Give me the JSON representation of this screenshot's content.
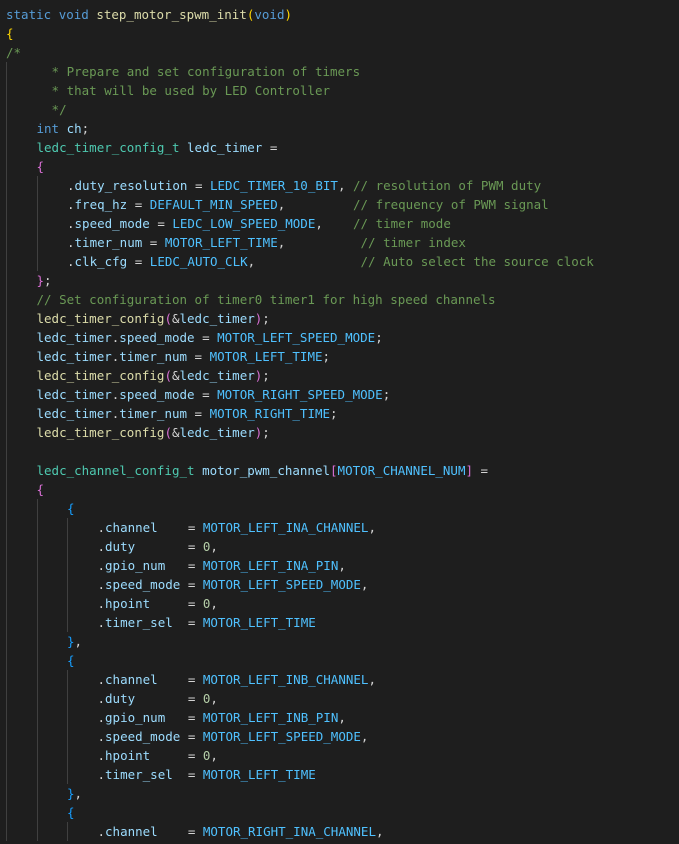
{
  "editor": {
    "language": "c",
    "colors": {
      "background": "#1e1e1e",
      "keyword": "#569cd6",
      "function": "#dcdcaa",
      "type": "#4ec9b0",
      "variable": "#9cdcfe",
      "macro": "#4fc1ff",
      "number": "#b5cea8",
      "comment": "#6a9955",
      "punctuation": "#d4d4d4",
      "bracket_level_1": "#ffd700",
      "bracket_level_2": "#da70d6",
      "bracket_level_3": "#179fff"
    },
    "lines": [
      {
        "indent": 0,
        "tokens": [
          [
            "kw",
            "static"
          ],
          [
            "pn",
            " "
          ],
          [
            "kw",
            "void"
          ],
          [
            "pn",
            " "
          ],
          [
            "fn",
            "step_motor_spwm_init"
          ],
          [
            "b1",
            "("
          ],
          [
            "kw",
            "void"
          ],
          [
            "b1",
            ")"
          ]
        ]
      },
      {
        "indent": 0,
        "tokens": [
          [
            "b1",
            "{"
          ]
        ]
      },
      {
        "indent": 0,
        "tokens": [
          [
            "cm",
            "/*"
          ]
        ]
      },
      {
        "indent": 1,
        "tokens": [
          [
            "cm",
            "  * Prepare and set configuration of timers"
          ]
        ]
      },
      {
        "indent": 1,
        "tokens": [
          [
            "cm",
            "  * that will be used by LED Controller"
          ]
        ]
      },
      {
        "indent": 1,
        "tokens": [
          [
            "cm",
            "  */"
          ]
        ]
      },
      {
        "indent": 1,
        "tokens": [
          [
            "kw",
            "int"
          ],
          [
            "pn",
            " "
          ],
          [
            "vr",
            "ch"
          ],
          [
            "pn",
            ";"
          ]
        ]
      },
      {
        "indent": 1,
        "tokens": [
          [
            "ty",
            "ledc_timer_config_t"
          ],
          [
            "pn",
            " "
          ],
          [
            "vr",
            "ledc_timer"
          ],
          [
            "pn",
            " ="
          ]
        ]
      },
      {
        "indent": 1,
        "tokens": [
          [
            "b2",
            "{"
          ]
        ]
      },
      {
        "indent": 2,
        "tokens": [
          [
            "pn",
            "."
          ],
          [
            "vr",
            "duty_resolution"
          ],
          [
            "pn",
            " = "
          ],
          [
            "mc",
            "LEDC_TIMER_10_BIT"
          ],
          [
            "pn",
            ", "
          ],
          [
            "cm",
            "// resolution of PWM duty"
          ]
        ]
      },
      {
        "indent": 2,
        "tokens": [
          [
            "pn",
            "."
          ],
          [
            "vr",
            "freq_hz"
          ],
          [
            "pn",
            " = "
          ],
          [
            "mc",
            "DEFAULT_MIN_SPEED"
          ],
          [
            "pn",
            ",         "
          ],
          [
            "cm",
            "// frequency of PWM signal"
          ]
        ]
      },
      {
        "indent": 2,
        "tokens": [
          [
            "pn",
            "."
          ],
          [
            "vr",
            "speed_mode"
          ],
          [
            "pn",
            " = "
          ],
          [
            "mc",
            "LEDC_LOW_SPEED_MODE"
          ],
          [
            "pn",
            ",    "
          ],
          [
            "cm",
            "// timer mode"
          ]
        ]
      },
      {
        "indent": 2,
        "tokens": [
          [
            "pn",
            "."
          ],
          [
            "vr",
            "timer_num"
          ],
          [
            "pn",
            " = "
          ],
          [
            "mc",
            "MOTOR_LEFT_TIME"
          ],
          [
            "pn",
            ",          "
          ],
          [
            "cm",
            "// timer index"
          ]
        ]
      },
      {
        "indent": 2,
        "tokens": [
          [
            "pn",
            "."
          ],
          [
            "vr",
            "clk_cfg"
          ],
          [
            "pn",
            " = "
          ],
          [
            "mc",
            "LEDC_AUTO_CLK"
          ],
          [
            "pn",
            ",              "
          ],
          [
            "cm",
            "// Auto select the source clock"
          ]
        ]
      },
      {
        "indent": 1,
        "tokens": [
          [
            "b2",
            "}"
          ],
          [
            "pn",
            ";"
          ]
        ]
      },
      {
        "indent": 1,
        "tokens": [
          [
            "cm",
            "// Set configuration of timer0 timer1 for high speed channels"
          ]
        ]
      },
      {
        "indent": 1,
        "tokens": [
          [
            "fn",
            "ledc_timer_config"
          ],
          [
            "b2",
            "("
          ],
          [
            "pn",
            "&"
          ],
          [
            "vr",
            "ledc_timer"
          ],
          [
            "b2",
            ")"
          ],
          [
            "pn",
            ";"
          ]
        ]
      },
      {
        "indent": 1,
        "tokens": [
          [
            "vr",
            "ledc_timer"
          ],
          [
            "pn",
            "."
          ],
          [
            "vr",
            "speed_mode"
          ],
          [
            "pn",
            " = "
          ],
          [
            "mc",
            "MOTOR_LEFT_SPEED_MODE"
          ],
          [
            "pn",
            ";"
          ]
        ]
      },
      {
        "indent": 1,
        "tokens": [
          [
            "vr",
            "ledc_timer"
          ],
          [
            "pn",
            "."
          ],
          [
            "vr",
            "timer_num"
          ],
          [
            "pn",
            " = "
          ],
          [
            "mc",
            "MOTOR_LEFT_TIME"
          ],
          [
            "pn",
            ";"
          ]
        ]
      },
      {
        "indent": 1,
        "tokens": [
          [
            "fn",
            "ledc_timer_config"
          ],
          [
            "b2",
            "("
          ],
          [
            "pn",
            "&"
          ],
          [
            "vr",
            "ledc_timer"
          ],
          [
            "b2",
            ")"
          ],
          [
            "pn",
            ";"
          ]
        ]
      },
      {
        "indent": 1,
        "tokens": [
          [
            "vr",
            "ledc_timer"
          ],
          [
            "pn",
            "."
          ],
          [
            "vr",
            "speed_mode"
          ],
          [
            "pn",
            " = "
          ],
          [
            "mc",
            "MOTOR_RIGHT_SPEED_MODE"
          ],
          [
            "pn",
            ";"
          ]
        ]
      },
      {
        "indent": 1,
        "tokens": [
          [
            "vr",
            "ledc_timer"
          ],
          [
            "pn",
            "."
          ],
          [
            "vr",
            "timer_num"
          ],
          [
            "pn",
            " = "
          ],
          [
            "mc",
            "MOTOR_RIGHT_TIME"
          ],
          [
            "pn",
            ";"
          ]
        ]
      },
      {
        "indent": 1,
        "tokens": [
          [
            "fn",
            "ledc_timer_config"
          ],
          [
            "b2",
            "("
          ],
          [
            "pn",
            "&"
          ],
          [
            "vr",
            "ledc_timer"
          ],
          [
            "b2",
            ")"
          ],
          [
            "pn",
            ";"
          ]
        ]
      },
      {
        "indent": 1,
        "tokens": []
      },
      {
        "indent": 1,
        "tokens": [
          [
            "ty",
            "ledc_channel_config_t"
          ],
          [
            "pn",
            " "
          ],
          [
            "vr",
            "motor_pwm_channel"
          ],
          [
            "b2",
            "["
          ],
          [
            "mc",
            "MOTOR_CHANNEL_NUM"
          ],
          [
            "b2",
            "]"
          ],
          [
            "pn",
            " ="
          ]
        ]
      },
      {
        "indent": 1,
        "tokens": [
          [
            "b2",
            "{"
          ]
        ]
      },
      {
        "indent": 2,
        "tokens": [
          [
            "b3",
            "{"
          ]
        ]
      },
      {
        "indent": 3,
        "tokens": [
          [
            "pn",
            "."
          ],
          [
            "vr",
            "channel"
          ],
          [
            "pn",
            "    = "
          ],
          [
            "mc",
            "MOTOR_LEFT_INA_CHANNEL"
          ],
          [
            "pn",
            ","
          ]
        ]
      },
      {
        "indent": 3,
        "tokens": [
          [
            "pn",
            "."
          ],
          [
            "vr",
            "duty"
          ],
          [
            "pn",
            "       = "
          ],
          [
            "nm",
            "0"
          ],
          [
            "pn",
            ","
          ]
        ]
      },
      {
        "indent": 3,
        "tokens": [
          [
            "pn",
            "."
          ],
          [
            "vr",
            "gpio_num"
          ],
          [
            "pn",
            "   = "
          ],
          [
            "mc",
            "MOTOR_LEFT_INA_PIN"
          ],
          [
            "pn",
            ","
          ]
        ]
      },
      {
        "indent": 3,
        "tokens": [
          [
            "pn",
            "."
          ],
          [
            "vr",
            "speed_mode"
          ],
          [
            "pn",
            " = "
          ],
          [
            "mc",
            "MOTOR_LEFT_SPEED_MODE"
          ],
          [
            "pn",
            ","
          ]
        ]
      },
      {
        "indent": 3,
        "tokens": [
          [
            "pn",
            "."
          ],
          [
            "vr",
            "hpoint"
          ],
          [
            "pn",
            "     = "
          ],
          [
            "nm",
            "0"
          ],
          [
            "pn",
            ","
          ]
        ]
      },
      {
        "indent": 3,
        "tokens": [
          [
            "pn",
            "."
          ],
          [
            "vr",
            "timer_sel"
          ],
          [
            "pn",
            "  = "
          ],
          [
            "mc",
            "MOTOR_LEFT_TIME"
          ]
        ]
      },
      {
        "indent": 2,
        "tokens": [
          [
            "b3",
            "}"
          ],
          [
            "pn",
            ","
          ]
        ]
      },
      {
        "indent": 2,
        "tokens": [
          [
            "b3",
            "{"
          ]
        ]
      },
      {
        "indent": 3,
        "tokens": [
          [
            "pn",
            "."
          ],
          [
            "vr",
            "channel"
          ],
          [
            "pn",
            "    = "
          ],
          [
            "mc",
            "MOTOR_LEFT_INB_CHANNEL"
          ],
          [
            "pn",
            ","
          ]
        ]
      },
      {
        "indent": 3,
        "tokens": [
          [
            "pn",
            "."
          ],
          [
            "vr",
            "duty"
          ],
          [
            "pn",
            "       = "
          ],
          [
            "nm",
            "0"
          ],
          [
            "pn",
            ","
          ]
        ]
      },
      {
        "indent": 3,
        "tokens": [
          [
            "pn",
            "."
          ],
          [
            "vr",
            "gpio_num"
          ],
          [
            "pn",
            "   = "
          ],
          [
            "mc",
            "MOTOR_LEFT_INB_PIN"
          ],
          [
            "pn",
            ","
          ]
        ]
      },
      {
        "indent": 3,
        "tokens": [
          [
            "pn",
            "."
          ],
          [
            "vr",
            "speed_mode"
          ],
          [
            "pn",
            " = "
          ],
          [
            "mc",
            "MOTOR_LEFT_SPEED_MODE"
          ],
          [
            "pn",
            ","
          ]
        ]
      },
      {
        "indent": 3,
        "tokens": [
          [
            "pn",
            "."
          ],
          [
            "vr",
            "hpoint"
          ],
          [
            "pn",
            "     = "
          ],
          [
            "nm",
            "0"
          ],
          [
            "pn",
            ","
          ]
        ]
      },
      {
        "indent": 3,
        "tokens": [
          [
            "pn",
            "."
          ],
          [
            "vr",
            "timer_sel"
          ],
          [
            "pn",
            "  = "
          ],
          [
            "mc",
            "MOTOR_LEFT_TIME"
          ]
        ]
      },
      {
        "indent": 2,
        "tokens": [
          [
            "b3",
            "}"
          ],
          [
            "pn",
            ","
          ]
        ]
      },
      {
        "indent": 2,
        "tokens": [
          [
            "b3",
            "{"
          ]
        ]
      },
      {
        "indent": 3,
        "tokens": [
          [
            "pn",
            "."
          ],
          [
            "vr",
            "channel"
          ],
          [
            "pn",
            "    = "
          ],
          [
            "mc",
            "MOTOR_RIGHT_INA_CHANNEL"
          ],
          [
            "pn",
            ","
          ]
        ]
      }
    ]
  }
}
